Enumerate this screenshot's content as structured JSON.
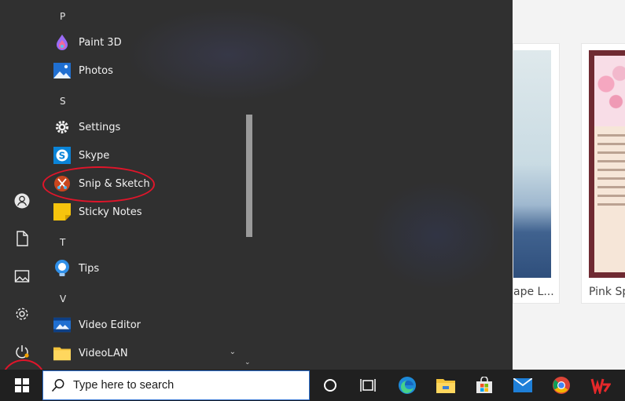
{
  "background": {
    "card1_caption": "ape L...",
    "card2_caption": "Pink Sp"
  },
  "start_menu": {
    "sections": [
      {
        "letter": "P",
        "apps": [
          {
            "label": "Paint 3D",
            "icon": "paint3d-icon"
          },
          {
            "label": "Photos",
            "icon": "photos-icon"
          }
        ]
      },
      {
        "letter": "S",
        "apps": [
          {
            "label": "Settings",
            "icon": "settings-gear-icon"
          },
          {
            "label": "Skype",
            "icon": "skype-icon"
          },
          {
            "label": "Snip & Sketch",
            "icon": "snip-sketch-icon"
          },
          {
            "label": "Sticky Notes",
            "icon": "sticky-notes-icon"
          }
        ]
      },
      {
        "letter": "T",
        "apps": [
          {
            "label": "Tips",
            "icon": "tips-bulb-icon"
          }
        ]
      },
      {
        "letter": "V",
        "apps": [
          {
            "label": "Video Editor",
            "icon": "video-editor-icon"
          },
          {
            "label": "VideoLAN",
            "icon": "folder-icon"
          }
        ]
      }
    ],
    "rail": [
      "user-account-icon",
      "documents-icon",
      "pictures-icon",
      "settings-icon",
      "power-icon"
    ]
  },
  "taskbar": {
    "search_placeholder": "Type here to search",
    "icons": [
      "cortana-icon",
      "task-view-icon",
      "edge-icon",
      "file-explorer-icon",
      "store-icon",
      "mail-icon",
      "chrome-icon",
      "wps-office-icon"
    ]
  },
  "colors": {
    "start_bg": "#303030",
    "taskbar_bg": "#202020",
    "annotation_red": "#e0152a",
    "search_border": "#2c6fd0"
  }
}
